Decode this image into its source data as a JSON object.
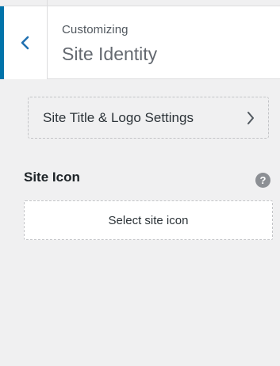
{
  "header": {
    "subtitle": "Customizing",
    "title": "Site Identity",
    "back_icon": "chevron-left-icon"
  },
  "section_link": {
    "label": "Site Title & Logo Settings",
    "icon": "chevron-right-icon"
  },
  "site_icon": {
    "label": "Site Icon",
    "help_glyph": "?",
    "select_button": "Select site icon"
  },
  "colors": {
    "accent": "#0073aa",
    "background": "#f0f0f1",
    "panel": "#ffffff",
    "help_icon": "#8c8f94"
  }
}
